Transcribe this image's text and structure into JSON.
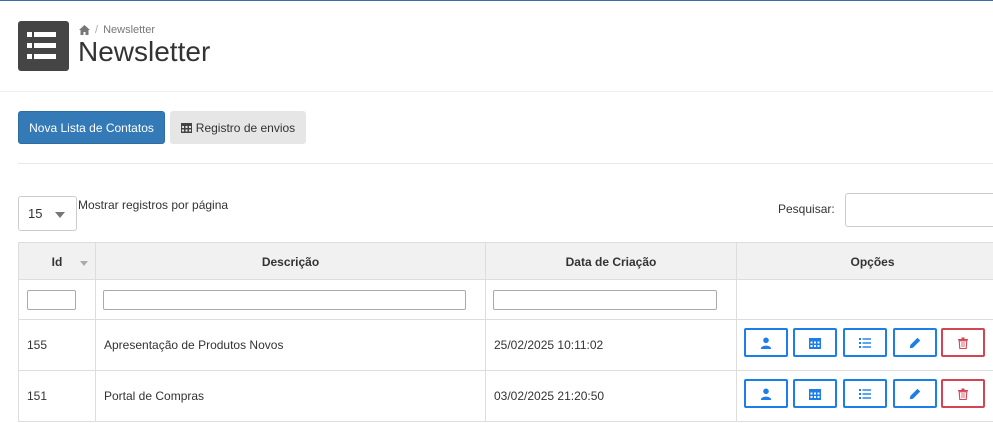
{
  "header": {
    "breadcrumb_current": "Newsletter",
    "breadcrumb_separator": "/",
    "title": "Newsletter"
  },
  "actions": {
    "new_list_label": "Nova Lista de Contatos",
    "send_log_label": "Registro de envios"
  },
  "table_controls": {
    "page_length_value": "15",
    "page_length_label": "Mostrar registros por página",
    "search_label": "Pesquisar:",
    "search_value": ""
  },
  "table": {
    "columns": [
      "Id",
      "Descrição",
      "Data de Criação",
      "Opções"
    ],
    "rows": [
      {
        "id": "155",
        "descricao": "Apresentação de Produtos Novos",
        "data": "25/02/2025 10:11:02"
      },
      {
        "id": "151",
        "descricao": "Portal de Compras",
        "data": "03/02/2025 21:20:50"
      }
    ],
    "row_options": [
      "user-icon",
      "calendar-icon",
      "list-icon",
      "pencil-icon",
      "trash-icon"
    ]
  },
  "colors": {
    "primary": "#337ab7",
    "option_border": "#1c7ee8",
    "danger": "#d44454"
  }
}
